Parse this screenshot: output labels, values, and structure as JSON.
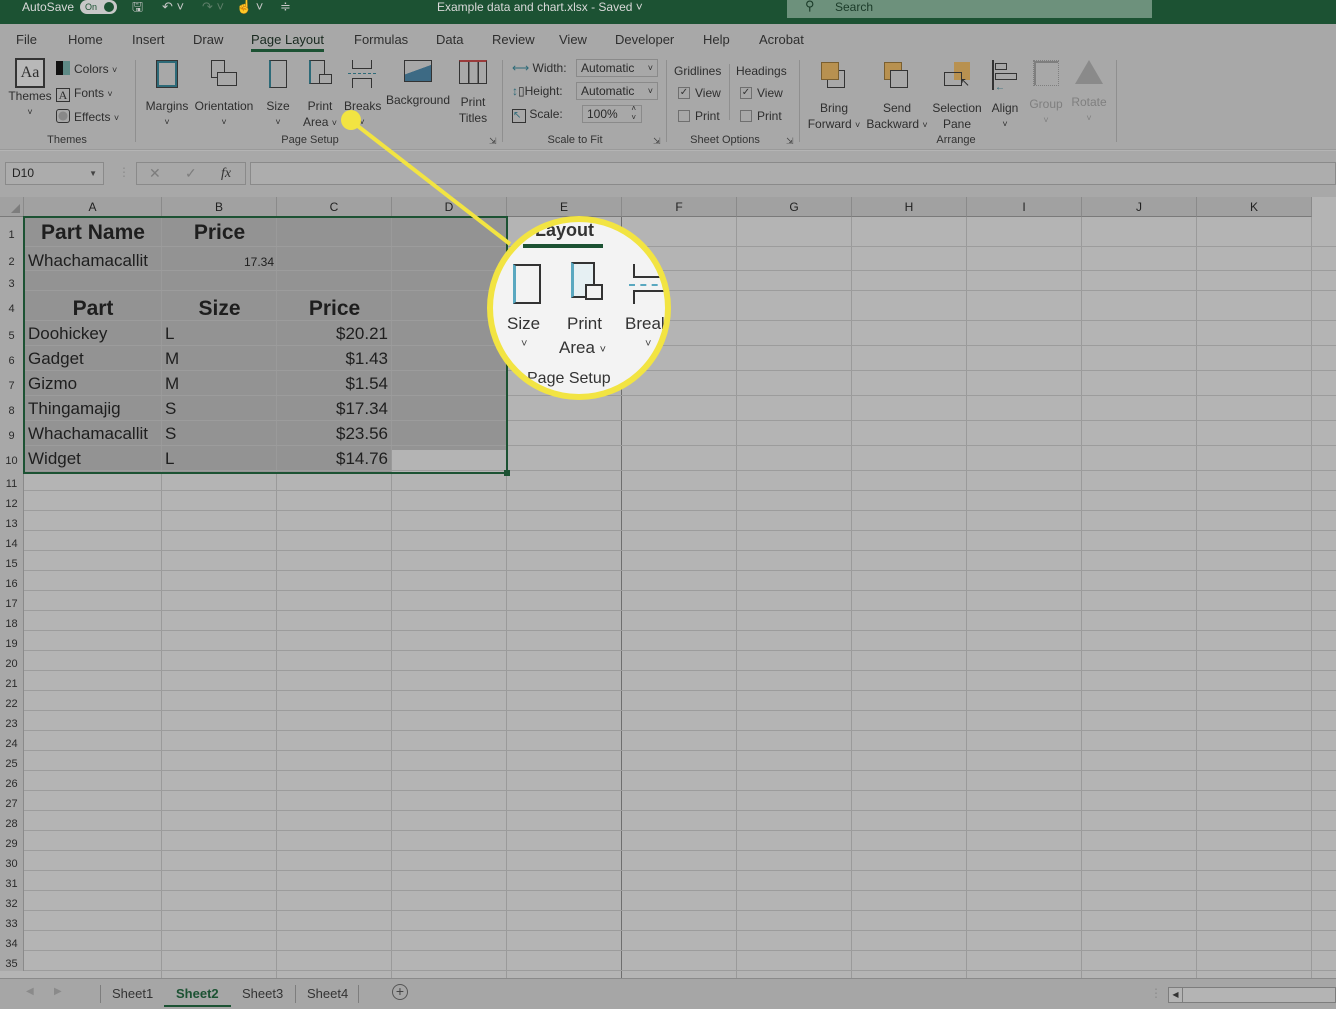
{
  "titlebar": {
    "autosave_label": "AutoSave",
    "autosave_state": "On",
    "doc_title": "Example data and chart.xlsx  -  Saved",
    "search_placeholder": "Search"
  },
  "tabs": [
    {
      "label": "File"
    },
    {
      "label": "Home"
    },
    {
      "label": "Insert"
    },
    {
      "label": "Draw"
    },
    {
      "label": "Page Layout",
      "active": true
    },
    {
      "label": "Formulas"
    },
    {
      "label": "Data"
    },
    {
      "label": "Review"
    },
    {
      "label": "View"
    },
    {
      "label": "Developer"
    },
    {
      "label": "Help"
    },
    {
      "label": "Acrobat"
    }
  ],
  "ribbon": {
    "themes": {
      "themes_label": "Themes",
      "colors": "Colors",
      "fonts": "Fonts",
      "effects": "Effects",
      "group": "Themes"
    },
    "page_setup": {
      "margins": "Margins",
      "orientation": "Orientation",
      "size": "Size",
      "print_area_1": "Print",
      "print_area_2": "Area",
      "breaks": "Breaks",
      "background": "Background",
      "print_titles_1": "Print",
      "print_titles_2": "Titles",
      "group": "Page Setup"
    },
    "scale_to_fit": {
      "width_label": "Width:",
      "width_value": "Automatic",
      "height_label": "Height:",
      "height_value": "Automatic",
      "scale_label": "Scale:",
      "scale_value": "100%",
      "group": "Scale to Fit"
    },
    "sheet_options": {
      "gridlines": "Gridlines",
      "headings": "Headings",
      "view": "View",
      "print": "Print",
      "gridlines_view": true,
      "gridlines_print": false,
      "headings_view": true,
      "headings_print": false,
      "group": "Sheet Options"
    },
    "arrange": {
      "bring_forward_1": "Bring",
      "bring_forward_2": "Forward",
      "send_backward_1": "Send",
      "send_backward_2": "Backward",
      "selection_pane_1": "Selection",
      "selection_pane_2": "Pane",
      "align": "Align",
      "group_btn": "Group",
      "rotate": "Rotate",
      "group": "Arrange"
    }
  },
  "formula_bar": {
    "name_box": "D10",
    "cancel": "✕",
    "enter": "✓",
    "fx": "fx",
    "value": ""
  },
  "columns": [
    "A",
    "B",
    "C",
    "D",
    "E",
    "F",
    "G",
    "H",
    "I",
    "J",
    "K"
  ],
  "rows": [
    "1",
    "2",
    "3",
    "4",
    "5",
    "6",
    "7",
    "8",
    "9",
    "10",
    "11",
    "12",
    "13",
    "14",
    "15",
    "16",
    "17",
    "18",
    "19",
    "20",
    "21",
    "22",
    "23",
    "24",
    "25",
    "26",
    "27",
    "28",
    "29",
    "30",
    "31",
    "32",
    "33",
    "34",
    "35"
  ],
  "cells": {
    "a1": "Part Name",
    "b1": "Price",
    "a2": "Whachamacallit",
    "b2": "17.34",
    "a4": "Part",
    "b4": "Size",
    "c4": "Price",
    "table": [
      {
        "part": "Doohickey",
        "size": "L",
        "price": "$20.21"
      },
      {
        "part": "Gadget",
        "size": "M",
        "price": "$1.43"
      },
      {
        "part": "Gizmo",
        "size": "M",
        "price": "$1.54"
      },
      {
        "part": "Thingamajig",
        "size": "S",
        "price": "$17.34"
      },
      {
        "part": "Whachamacallit",
        "size": "S",
        "price": "$23.56"
      },
      {
        "part": "Widget",
        "size": "L",
        "price": "$14.76"
      }
    ]
  },
  "callout": {
    "tab_fragment": "Layout",
    "size": "Size",
    "print": "Print",
    "area": "Area",
    "breaks": "Break",
    "group": "Page Setup",
    "color": "#f2e442"
  },
  "sheets": [
    {
      "label": "Sheet1"
    },
    {
      "label": "Sheet2",
      "active": true
    },
    {
      "label": "Sheet3"
    },
    {
      "label": "Sheet4"
    }
  ],
  "add_sheet": "+"
}
